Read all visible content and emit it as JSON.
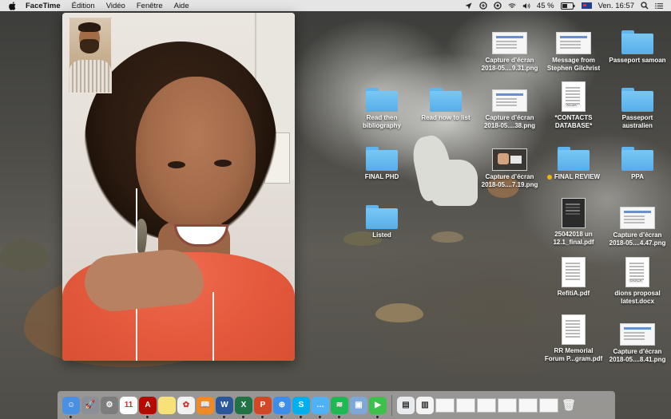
{
  "menubar": {
    "app_name": "FaceTime",
    "menus": [
      "Édition",
      "Vidéo",
      "Fenêtre",
      "Aide"
    ],
    "battery": "45 %",
    "clock": "Ven. 16:57",
    "status_icons": [
      "location-icon",
      "sync-icon",
      "vpn-icon",
      "wifi-icon",
      "volume-icon",
      "battery-icon",
      "input-flag-icon",
      "search-icon",
      "notification-center-icon"
    ]
  },
  "desktop": {
    "icons": [
      {
        "label": "Capture d’écran\n2018-05....9.31.png",
        "kind": "screenshot"
      },
      {
        "label": "Message from\nStephen Gilchrist",
        "kind": "screenshot"
      },
      {
        "label": "Passeport samoan",
        "kind": "folder"
      },
      {
        "label": "Read then\nbibliography",
        "kind": "folder"
      },
      {
        "label": "Read now to list",
        "kind": "folder"
      },
      {
        "label": "Capture d’écran\n2018-05....38.png",
        "kind": "screenshot"
      },
      {
        "label": "*CONTACTS\nDATABASE*",
        "kind": "xlsx"
      },
      {
        "label": "Passeport\naustralien",
        "kind": "folder"
      },
      {
        "label": "FINAL PHD",
        "kind": "folder"
      },
      {
        "label": "Capture d’écran\n2018-05....7.19.png",
        "kind": "photo"
      },
      {
        "label": "FINAL REVIEW",
        "kind": "folder-tagged",
        "tag_color": "#f5b400"
      },
      {
        "label": "PPA",
        "kind": "folder"
      },
      {
        "label": "Listed",
        "kind": "folder"
      },
      {
        "label": "25042018 un\n12.1_final.pdf",
        "kind": "pdf-dark"
      },
      {
        "label": "Capture d’écran\n2018-05....4.47.png",
        "kind": "screenshot"
      },
      {
        "label": "RefitiA.pdf",
        "kind": "pdf"
      },
      {
        "label": "dions proposal\nlatest.docx",
        "kind": "docx"
      },
      {
        "label": "RR Memorial\nForum P...gram.pdf",
        "kind": "pdf"
      },
      {
        "label": "Capture d’écran\n2018-05....8.41.png",
        "kind": "screenshot"
      }
    ]
  },
  "dock": {
    "apps": [
      {
        "name": "finder",
        "color": "#4a90e2",
        "glyph": "☺",
        "running": true
      },
      {
        "name": "launchpad",
        "color": "#8a8f98",
        "glyph": "🚀",
        "running": false
      },
      {
        "name": "system-preferences",
        "color": "#7d7d7d",
        "glyph": "⚙",
        "running": false
      },
      {
        "name": "calendar",
        "color": "#ffffff",
        "glyph": "11",
        "running": false
      },
      {
        "name": "acrobat",
        "color": "#b30b00",
        "glyph": "A",
        "running": true
      },
      {
        "name": "stickies",
        "color": "#f7e27a",
        "glyph": "",
        "running": false
      },
      {
        "name": "photos",
        "color": "#f1f1f1",
        "glyph": "✿",
        "running": false
      },
      {
        "name": "books",
        "color": "#f08a24",
        "glyph": "📖",
        "running": false
      },
      {
        "name": "word",
        "color": "#2b579a",
        "glyph": "W",
        "running": true
      },
      {
        "name": "excel",
        "color": "#217346",
        "glyph": "X",
        "running": true
      },
      {
        "name": "powerpoint",
        "color": "#d24726",
        "glyph": "P",
        "running": true
      },
      {
        "name": "safari",
        "color": "#3d8ee8",
        "glyph": "⊕",
        "running": true
      },
      {
        "name": "skype",
        "color": "#00aff0",
        "glyph": "S",
        "running": true
      },
      {
        "name": "messages",
        "color": "#4fb2f7",
        "glyph": "…",
        "running": true
      },
      {
        "name": "spotify",
        "color": "#1db954",
        "glyph": "≋",
        "running": true
      },
      {
        "name": "preview",
        "color": "#7fa8d8",
        "glyph": "▣",
        "running": false
      },
      {
        "name": "facetime",
        "color": "#3ec14a",
        "glyph": "▶",
        "running": true
      }
    ]
  }
}
